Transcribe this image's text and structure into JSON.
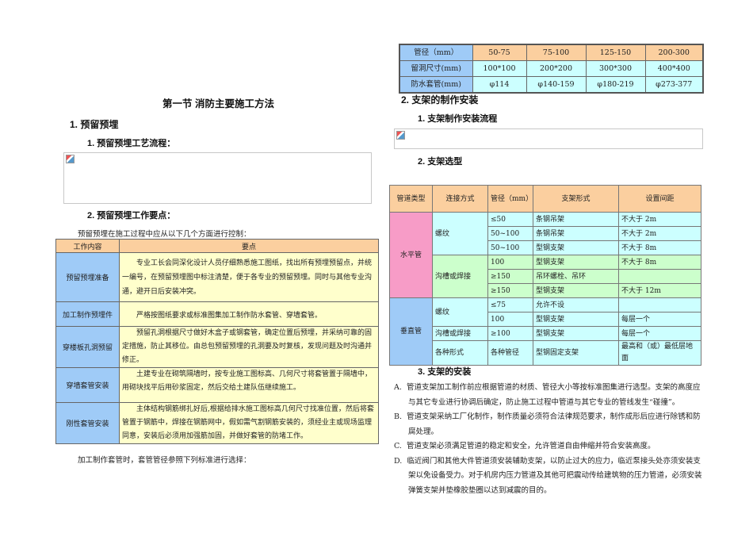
{
  "left": {
    "title": "第一节 消防主要施工方法",
    "s1": "1. 预留预埋",
    "s1_1": "1. 预留预埋工艺流程：",
    "s1_2": "2. 预留预埋工作要点：",
    "intro": "预留预埋在施工过程中应从以下几个方面进行控制：",
    "table": {
      "headers": [
        "工作内容",
        "要点"
      ],
      "rows": [
        {
          "item": "预留预埋准备",
          "text": "专业工长会同深化设计人员仔细熟悉施工图纸，找出所有预埋预留点，并统一编号，在预留预埋图中标注清楚，便于各专业的预留预埋。同时与其他专业沟通，避开日后安装冲突。"
        },
        {
          "item": "加工制作预埋件",
          "text": "严格按图纸要求或标准图集加工制作防水套管、穿墙套管。"
        },
        {
          "item": "穿楼板孔洞预留",
          "text": "预留孔洞根据尺寸做好木盒子或钢套管，确定位置后预埋，并采纳可靠的固定措施，防止其移位。由总包预留预埋的孔洞要及时复核，发现问题及时沟通并修正。"
        },
        {
          "item": "穿墙套管安装",
          "text": "土建专业在砌筑隔墙时，按专业施工图标高、几何尺寸将套管置于隔墙中，用砌块找平后用砂浆固定，然后交给土建队伍继续施工。"
        },
        {
          "item": "刚性套管安装",
          "text": "主体结构钢筋绑扎好后,根据给排水施工图标高几何尺寸找准位置，然后将套管置于钢筋中，焊接在钢筋网中，假如需气割钢筋安装的，须经业主或现场监理同意，安装后必须用加强筋加固，并做好套管的防堵工作。"
        }
      ]
    },
    "footer": "加工制作套管时，套管管径参照下列标准进行选择："
  },
  "right": {
    "sleeve_table": {
      "rows": [
        [
          "管径（mm）",
          "50-75",
          "75-100",
          "125-150",
          "200-300"
        ],
        [
          "留洞尺寸(mm)",
          "100*100",
          "200*200",
          "300*300",
          "400*400"
        ],
        [
          "防水套管(mm)",
          "φ114",
          "φ140-159",
          "φ180-219",
          "φ273-377"
        ]
      ]
    },
    "s2": "2. 支架的制作安装",
    "s2_1": "1. 支架制作安装流程",
    "s2_2": "2. 支架选型",
    "support_table": {
      "headers": [
        "管道类型",
        "连接方式",
        "管径（mm）",
        "支架形式",
        "设置间距"
      ],
      "horizontal": "水平管",
      "vertical": "垂直管",
      "thread": "螺纹",
      "groove": "沟槽或焊接",
      "groove2": "沟槽或焊接",
      "all": "各种形式",
      "allsize": "各种管径",
      "rows": [
        [
          "≤50",
          "条钢吊架",
          "不大于 2m"
        ],
        [
          "50~100",
          "条钢吊架",
          "不大于 2m"
        ],
        [
          "50~100",
          "型钢支架",
          "不大于 8m"
        ],
        [
          "100",
          "型钢支架",
          "不大于 8m"
        ],
        [
          "≥150",
          "吊环螺栓、吊环",
          ""
        ],
        [
          "≥150",
          "型钢支架",
          "不大于 12m"
        ],
        [
          "≤75",
          "允许不设",
          ""
        ],
        [
          "100",
          "型钢支架",
          "每层一个"
        ],
        [
          "≥100",
          "型钢支架",
          "每层一个"
        ],
        [
          "型钢固定支架",
          "最高和（或）最低层地面"
        ]
      ]
    },
    "s3": "3. 支架的安装",
    "items": [
      {
        "k": "A.",
        "t": "管道支架加工制作前应根据管道的材质、管径大小等按标准图集进行选型。支架的高度应与其它专业进行协调后确定，防止施工过程中管道与其它专业的管线发生“碰撞”。"
      },
      {
        "k": "B.",
        "t": "管道支架采纳工厂化制作，制作质量必须符合法律规范要求，制作成形后应进行除锈和防腐处理。"
      },
      {
        "k": "C.",
        "t": "管道支架必须满足管道的稳定和安全，允许管道自由伸缩并符合安装高度。"
      },
      {
        "k": "D.",
        "t": "临近阀门和其他大件管道须安装辅助支架，以防止过大的应力，临近泵接头处亦须安装支架以免设备受力。对于机房内压力管道及其他可把震动传给建筑物的压力管道，必须安装弹簧支架并垫橡胶垫圈以达到减震的目的。"
      }
    ]
  }
}
